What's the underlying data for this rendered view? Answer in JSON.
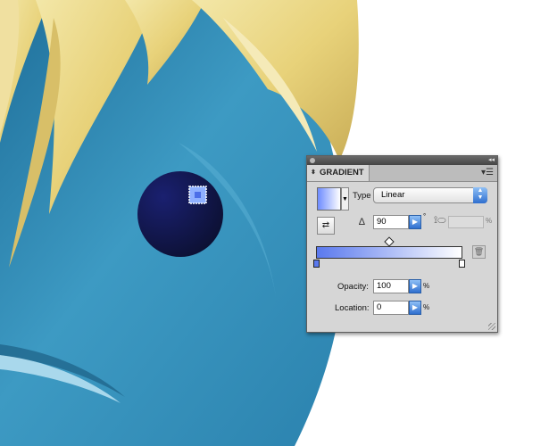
{
  "panel": {
    "tab_title": "GRADIENT",
    "collapse_icon": "double-chevron-right-icon",
    "menu_icon": "panel-menu-icon"
  },
  "gradient": {
    "type_label": "Type",
    "type_value": "Linear",
    "angle_value": "90",
    "angle_unit": "°",
    "aspect_unit": "%",
    "opacity_label": "Opacity:",
    "opacity_value": "100",
    "opacity_unit": "%",
    "location_label": "Location:",
    "location_value": "0",
    "location_unit": "%",
    "stop_left_color": "#5a79ee",
    "stop_right_color": "#ffffff",
    "midpoint_percent": 50
  }
}
